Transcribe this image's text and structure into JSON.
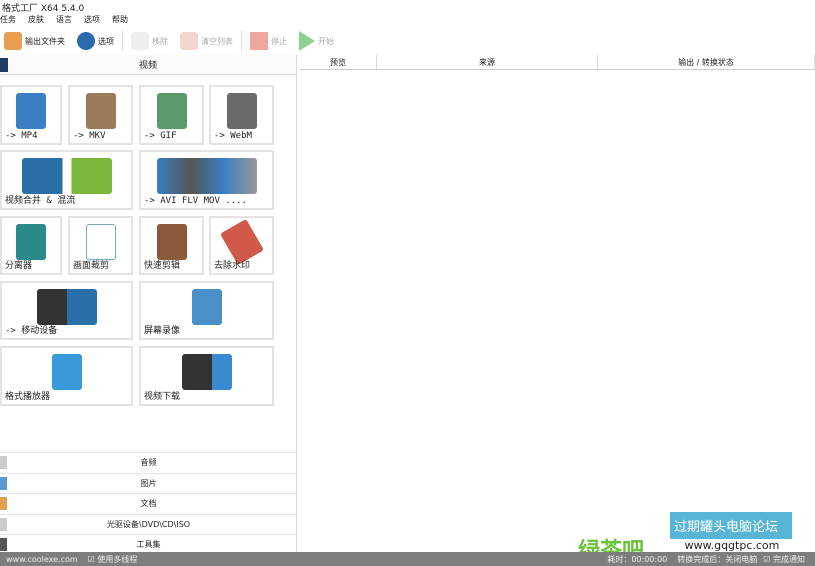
{
  "window": {
    "title": "格式工厂 X64 5.4.0"
  },
  "menu": [
    "任务",
    "皮肤",
    "语言",
    "选项",
    "帮助"
  ],
  "toolbar": {
    "output_folder": "输出文件夹",
    "options": "选项",
    "remove": "移除",
    "clear_list": "清空列表",
    "stop": "停止",
    "start": "开始"
  },
  "category": {
    "video": "视频"
  },
  "tiles": [
    "-> MP4",
    "-> MKV",
    "-> GIF",
    "-> WebM",
    "视频合并 & 混流",
    "-> AVI FLV MOV ....",
    "分离器",
    "画面裁剪",
    "快速剪辑",
    "去除水印",
    "-> 移动设备",
    "屏幕录像",
    "格式播放器",
    "视频下载"
  ],
  "tile_badges": [
    "MP4",
    "MKV",
    "GIF",
    "WebM"
  ],
  "categories": [
    "音频",
    "图片",
    "文档",
    "光驱设备\\DVD\\CD\\ISO",
    "工具集"
  ],
  "table": {
    "headers": [
      "预览",
      "来源",
      "输出 / 转换状态"
    ]
  },
  "status": {
    "website": "www.coolexe.com",
    "multithread": "使用多线程",
    "elapsed": "耗时：00:00:00",
    "after": "转换完成后：关闭电脑",
    "notify": "完成通知"
  },
  "watermark": {
    "forum": "过期罐头电脑论坛",
    "url": "www.gqgtpc.com",
    "brand": "绿茶吧"
  }
}
